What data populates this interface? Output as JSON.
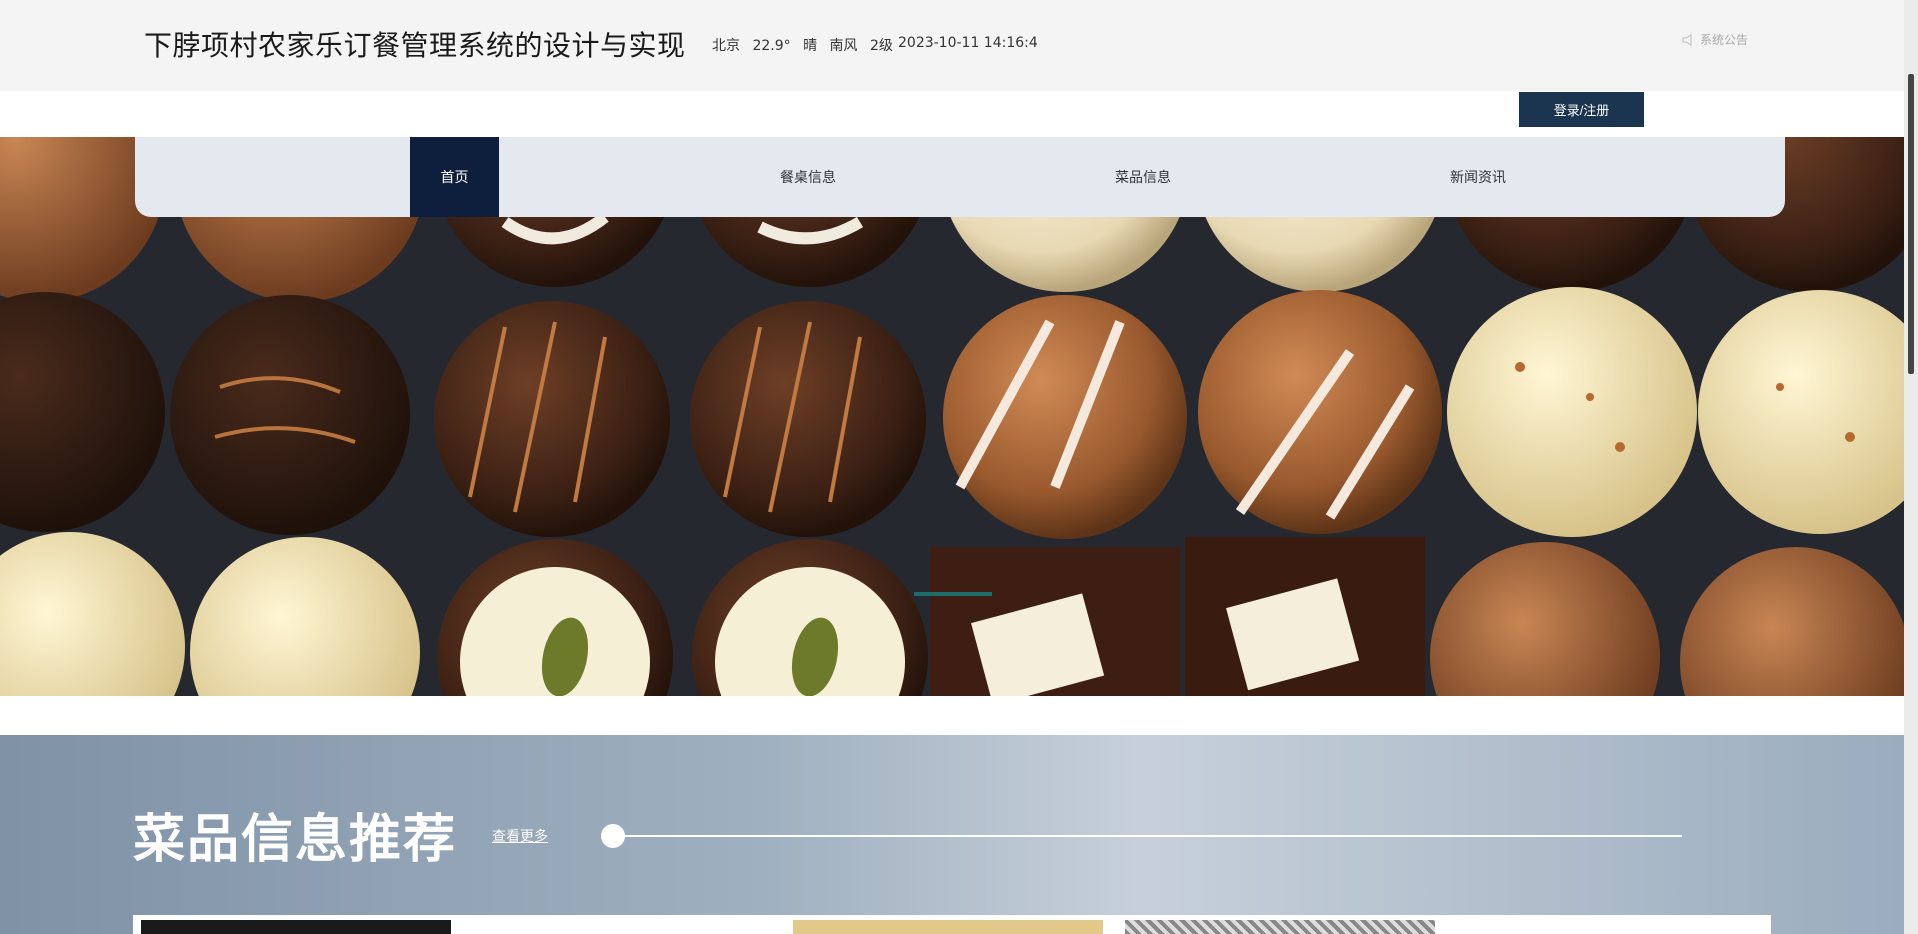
{
  "header": {
    "site_title": "下脖项村农家乐订餐管理系统的设计与实现",
    "weather": {
      "city": "北京",
      "temperature": "22.9°",
      "condition": "晴",
      "wind_direction": "南风",
      "wind_level": "2级"
    },
    "datetime": "2023-10-11 14:16:4",
    "notice_label": "系统公告",
    "login_label": "登录/注册"
  },
  "nav": {
    "items": [
      {
        "label": "首页",
        "active": true
      },
      {
        "label": "餐桌信息",
        "active": false
      },
      {
        "label": "菜品信息",
        "active": false
      },
      {
        "label": "新闻资讯",
        "active": false
      }
    ]
  },
  "recommend": {
    "title": "菜品信息推荐",
    "more_label": "查看更多"
  },
  "colors": {
    "nav_active_bg": "#0e1f3d",
    "login_btn_bg": "#1b3550",
    "nav_bg": "#e4e9f0"
  }
}
